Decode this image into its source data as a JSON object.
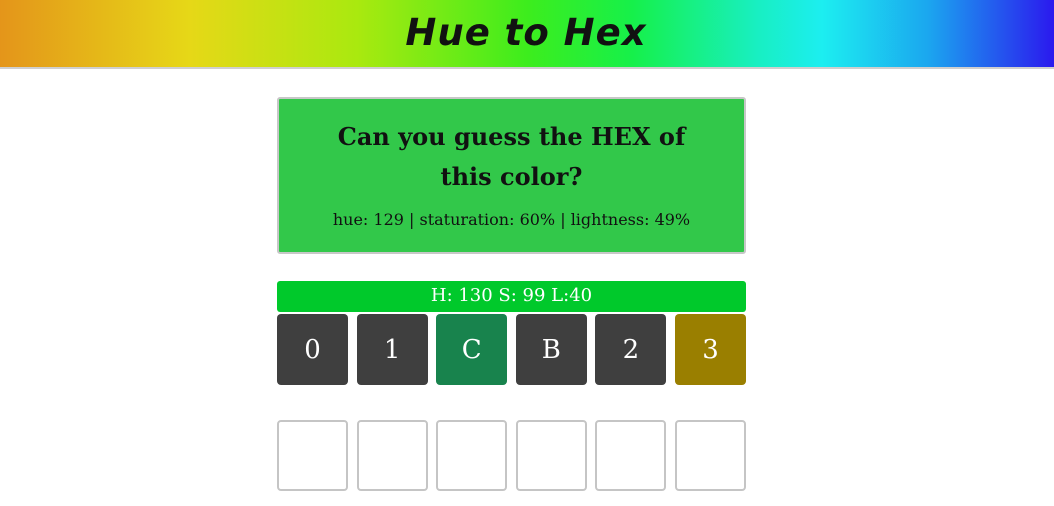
{
  "header": {
    "title": "Hue to Hex"
  },
  "prompt": {
    "question": "Can you guess the HEX of this color?",
    "hsl_text": "hue: 129 | staturation: 60% | lightness: 49%",
    "target_color": "#32c84a",
    "target_hsl": {
      "hue": 129,
      "saturation": 60,
      "lightness": 49
    }
  },
  "guesses": [
    {
      "label": "H: 130 S: 99 L:40",
      "label_color": "#00c92b",
      "tiles": [
        {
          "char": "0",
          "status": "absent",
          "color": "#3f3f3f"
        },
        {
          "char": "1",
          "status": "absent",
          "color": "#3f3f3f"
        },
        {
          "char": "C",
          "status": "correct",
          "color": "#18834d"
        },
        {
          "char": "B",
          "status": "absent",
          "color": "#3f3f3f"
        },
        {
          "char": "2",
          "status": "absent",
          "color": "#3f3f3f"
        },
        {
          "char": "3",
          "status": "present",
          "color": "#9a7f00"
        }
      ]
    }
  ],
  "current_input": [
    "",
    "",
    "",
    "",
    "",
    ""
  ],
  "colors": {
    "absent": "#3f3f3f",
    "correct": "#18834d",
    "present": "#9a7f00",
    "empty_border": "#c5c5c5"
  }
}
